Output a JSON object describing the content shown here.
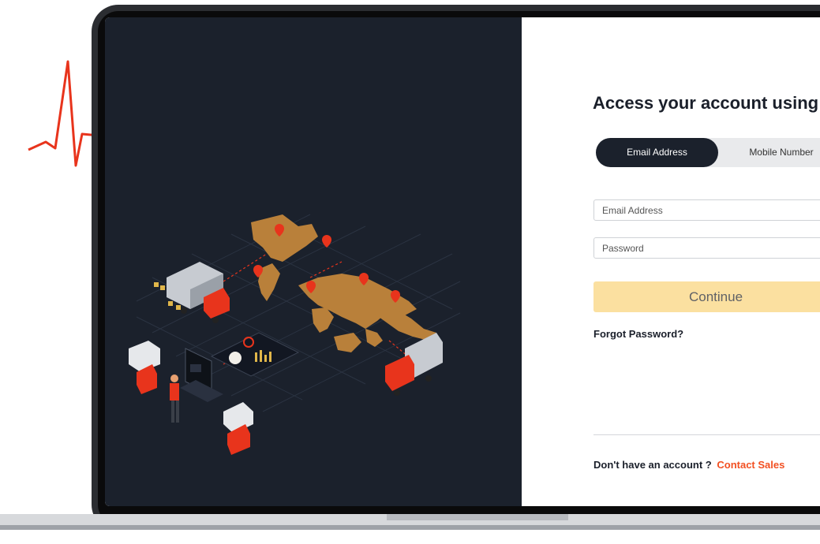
{
  "login": {
    "title": "Access your account using",
    "tabs": [
      "Email Address",
      "Mobile Number"
    ],
    "active_tab": "Email Address",
    "email_placeholder": "Email Address",
    "password_placeholder": "Password",
    "continue_label": "Continue",
    "forgot_label": "Forgot Password?",
    "signup_prompt": "Don't have an account ?",
    "contact_label": "Contact Sales"
  },
  "colors": {
    "dark_navy": "#1b212c",
    "accent_orange": "#f25022",
    "button_yellow": "#fbe0a0",
    "brand_red": "#e8341c",
    "map_gold": "#b9803a"
  },
  "illustration": {
    "icons": [
      "world-map",
      "location-pin",
      "delivery-truck",
      "worker",
      "computer-monitor",
      "dashboard-panel",
      "laptop",
      "printer"
    ]
  }
}
